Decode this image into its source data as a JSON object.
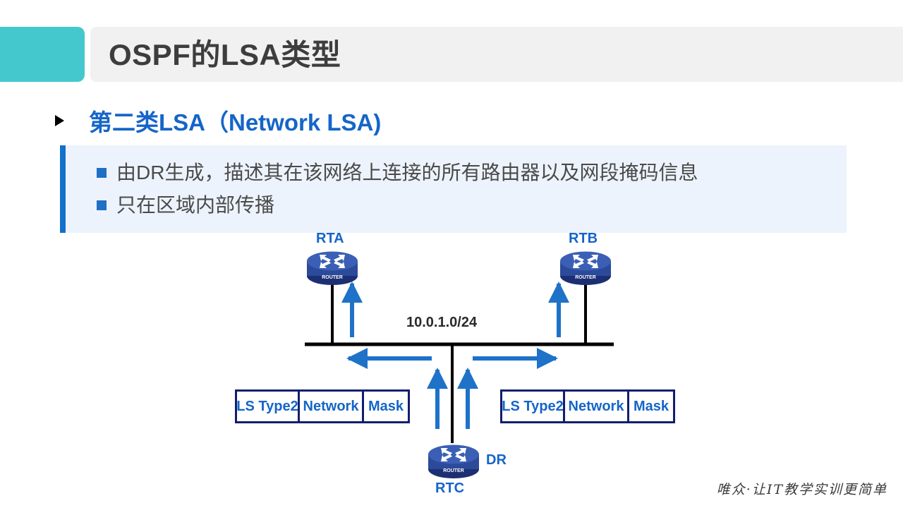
{
  "header": {
    "title": "OSPF的LSA类型",
    "accent_color": "#45c8cd",
    "bar_color": "#f1f1f1"
  },
  "subtitle": {
    "text": "第二类LSA（Network LSA)",
    "color": "#1565c8",
    "bullet_icon": "triangle-right-icon"
  },
  "body": {
    "accent_color": "#1271c8",
    "background": "#edf3fc",
    "items": [
      {
        "text": "由DR生成，描述其在该网络上连接的所有路由器以及网段掩码信息"
      },
      {
        "text": "只在区域内部传播"
      }
    ]
  },
  "diagram": {
    "network_label": "10.0.1.0/24",
    "routers": [
      {
        "id": "rta",
        "label": "RTA",
        "icon": "router-icon"
      },
      {
        "id": "rtb",
        "label": "RTB",
        "icon": "router-icon"
      },
      {
        "id": "rtc",
        "label": "RTC",
        "icon": "router-icon",
        "role": "DR"
      }
    ],
    "dr_badge": "DR",
    "lsa_left": {
      "cells": [
        "LS Type2",
        "Network",
        "Mask"
      ]
    },
    "lsa_right": {
      "cells": [
        "LS Type2",
        "Network",
        "Mask"
      ]
    },
    "link_color": "#000000",
    "flow_color": "#1e72c8"
  },
  "footer": {
    "watermark": "唯众·让IT教学实训更简单"
  }
}
